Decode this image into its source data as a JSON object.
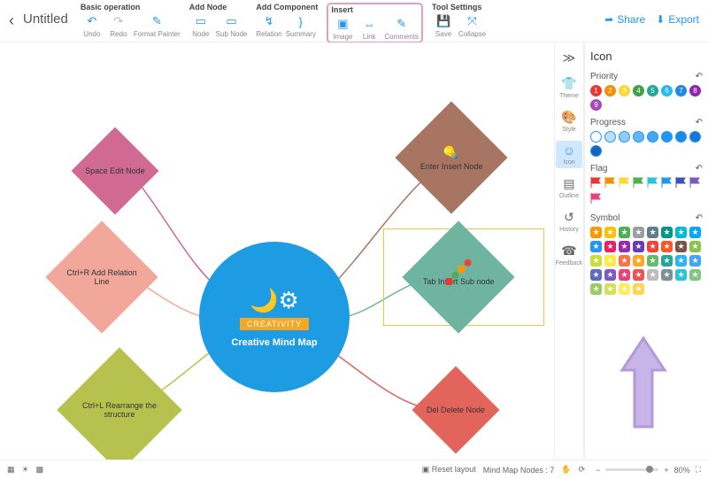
{
  "doc": {
    "title": "Untitled"
  },
  "toolbar": {
    "groups": {
      "basic": {
        "label": "Basic operation",
        "undo": "Undo",
        "redo": "Redo",
        "format_painter": "Format Painter"
      },
      "add_node": {
        "label": "Add Node",
        "node": "Node",
        "sub_node": "Sub Node"
      },
      "add_component": {
        "label": "Add Component",
        "relation": "Relation",
        "summary": "Summary"
      },
      "insert": {
        "label": "Insert",
        "image": "Image",
        "link": "Link",
        "comments": "Comments"
      },
      "tool": {
        "label": "Tool Settings",
        "save": "Save",
        "collapse": "Collapse"
      }
    },
    "share": "Share",
    "export": "Export"
  },
  "rail": {
    "collapse": "≫",
    "theme": "Theme",
    "style": "Style",
    "icon": "Icon",
    "outline": "Outline",
    "history": "History",
    "feedback": "Feedback"
  },
  "panel": {
    "title": "Icon",
    "priority": {
      "label": "Priority",
      "colors": [
        "#e53935",
        "#fb8c00",
        "#fdd835",
        "#43a047",
        "#26a69a",
        "#29b6f6",
        "#1e88e5",
        "#8e24aa",
        "#ab47bc"
      ]
    },
    "progress": {
      "label": "Progress",
      "colors": [
        "#ffffff",
        "#bbdefb",
        "#90caf9",
        "#64b5f6",
        "#42a5f5",
        "#2196f3",
        "#1e88e5",
        "#1976d2",
        "#1565c0"
      ]
    },
    "flag": {
      "label": "Flag",
      "colors": [
        "#e53935",
        "#fb8c00",
        "#fdd835",
        "#4caf50",
        "#26c6da",
        "#2196f3",
        "#3f51b5",
        "#7e57c2",
        "#ec407a"
      ]
    },
    "symbol": {
      "label": "Symbol",
      "items": [
        "#ff9800",
        "#ffc107",
        "#4caf50",
        "#9e9e9e",
        "#607d8b",
        "#009688",
        "#00bcd4",
        "#03a9f4",
        "#2196f3",
        "#e91e63",
        "#9c27b0",
        "#673ab7",
        "#f44336",
        "#ff5722",
        "#795548",
        "#8bc34a",
        "#cddc39",
        "#ffeb3b",
        "#ff7043",
        "#ffa726",
        "#66bb6a",
        "#26a69a",
        "#29b6f6",
        "#42a5f5",
        "#5c6bc0",
        "#7e57c2",
        "#ec407a",
        "#ef5350",
        "#bdbdbd",
        "#78909c",
        "#26c6da",
        "#81c784",
        "#9ccc65",
        "#d4e157",
        "#ffee58",
        "#ffd54f"
      ]
    }
  },
  "canvas": {
    "center": {
      "ribbon": "CREATIVITY",
      "title": "Creative Mind Map"
    },
    "nodes": {
      "n1": {
        "label": "Space Edit Node"
      },
      "n2": {
        "label": "Ctrl+R Add Relation Line"
      },
      "n3": {
        "label": "Ctrl+L Rearrange the structure"
      },
      "n4": {
        "label": "Enter Insert Node"
      },
      "n5": {
        "label": "Tab Insert Sub node"
      },
      "n6": {
        "label": "Del Delete Node"
      }
    }
  },
  "status": {
    "reset": "Reset layout",
    "nodes_label": "Mind Map Nodes :",
    "nodes_count": "7",
    "zoom": "80%"
  }
}
